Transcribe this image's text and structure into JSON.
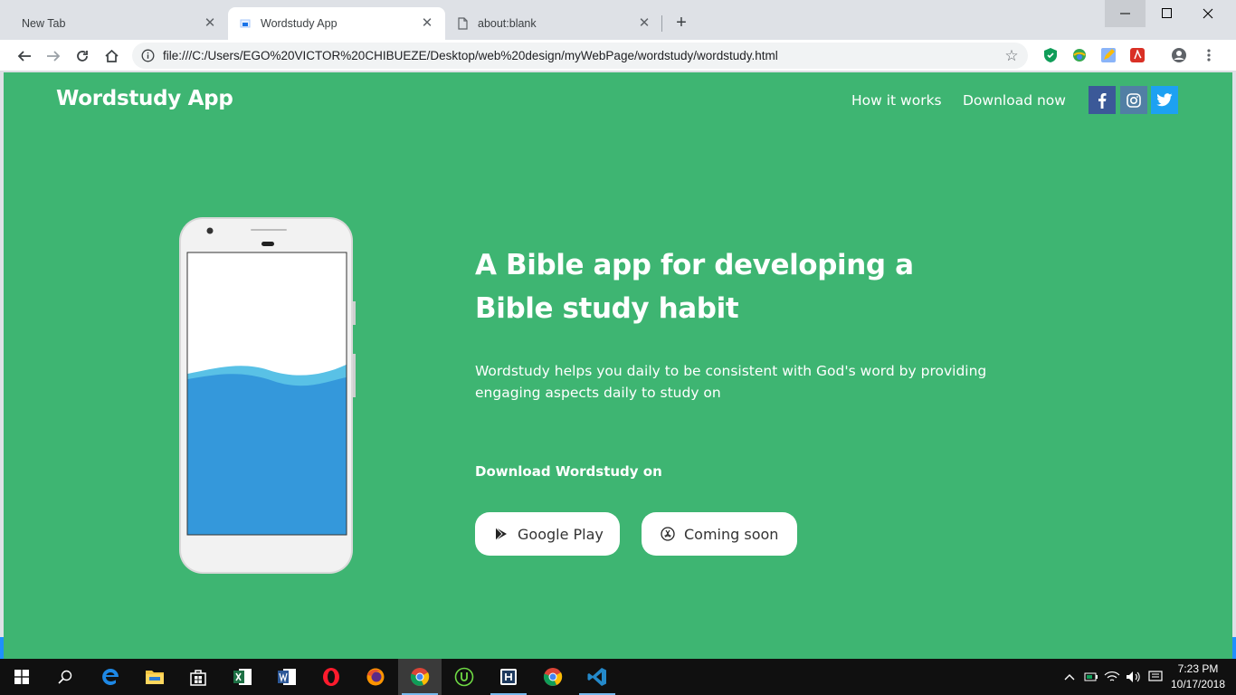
{
  "browser": {
    "tabs": [
      {
        "title": "New Tab",
        "active": false
      },
      {
        "title": "Wordstudy App",
        "active": true
      },
      {
        "title": "about:blank",
        "active": false
      }
    ],
    "address": "file:///C:/Users/EGO%20VICTOR%20CHIBUEZE/Desktop/web%20design/myWebPage/wordstudy/wordstudy.html"
  },
  "site": {
    "brand": "Wordstudy App",
    "nav": {
      "how_it_works": "How it works",
      "download_now": "Download now"
    },
    "social": [
      "facebook-icon",
      "instagram-icon",
      "twitter-icon"
    ],
    "hero": {
      "headline_line1": "A Bible app for developing a",
      "headline_line2": "Bible study habit",
      "subtitle": "Wordstudy helps you daily to be consistent with God's word by providing engaging aspects daily to study on",
      "download_label": "Download Wordstudy on",
      "google_play_label": "Google Play",
      "coming_soon_label": "Coming soon"
    },
    "colors": {
      "background": "#3eb572",
      "facebook": "#3b5998",
      "instagram": "#517fa4",
      "twitter": "#1da1f2"
    }
  },
  "taskbar": {
    "time": "7:23 PM",
    "date": "10/17/2018"
  }
}
